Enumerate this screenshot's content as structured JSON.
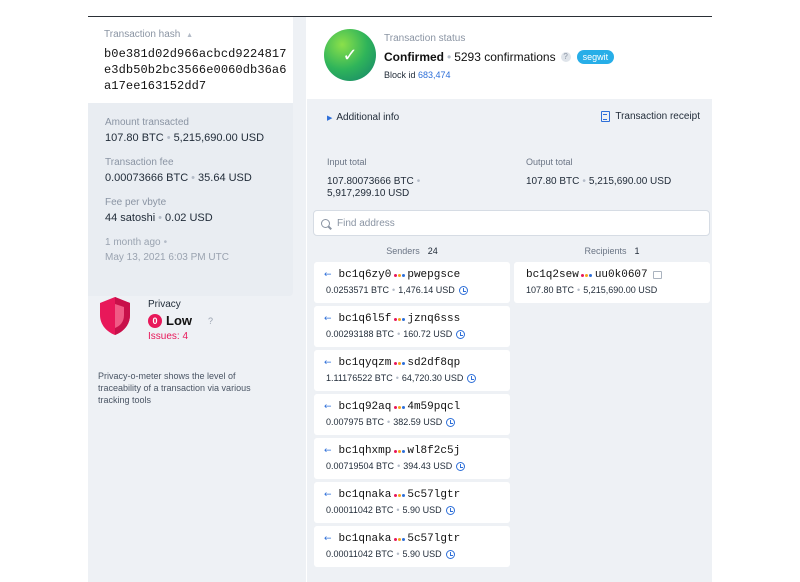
{
  "tx": {
    "hash_label": "Transaction hash",
    "hash_lines": [
      "b0e381d02d966acbcd9224817",
      "e3db50b2bc3566e0060db36a6",
      "a17ee163152dd7"
    ],
    "amount_label": "Amount transacted",
    "amount_btc": "107.80 BTC",
    "amount_usd": "5,215,690.00 USD",
    "fee_label": "Transaction fee",
    "fee_btc": "0.00073666 BTC",
    "fee_usd": "35.64 USD",
    "fee_vbyte_label": "Fee per vbyte",
    "fee_vbyte_sat": "44 satoshi",
    "fee_vbyte_usd": "0.02 USD",
    "time_ago": "1 month ago",
    "time_full": "May 13, 2021 6:03 PM UTC"
  },
  "privacy": {
    "label": "Privacy",
    "score": "0",
    "level": "Low",
    "help": "?",
    "issues": "Issues: 4",
    "description": "Privacy-o-meter shows the level of traceability of a transaction via various tracking tools",
    "color": "#e8185a"
  },
  "status": {
    "label": "Transaction status",
    "state": "Confirmed",
    "confirmations": "5293 confirmations",
    "help": "?",
    "badge": "segwit",
    "block_label": "Block id",
    "block_id": "683,474",
    "check_glyph": "✓"
  },
  "links": {
    "additional_info": "Additional info",
    "receipt": "Transaction receipt"
  },
  "totals": {
    "input_label": "Input total",
    "input_btc": "107.80073666 BTC",
    "input_usd": "5,917,299.10 USD",
    "output_label": "Output total",
    "output_btc": "107.80 BTC",
    "output_usd": "5,215,690.00 USD"
  },
  "search": {
    "placeholder": "Find address"
  },
  "senders": {
    "label": "Senders",
    "count": "24",
    "items": [
      {
        "addr_a": "bc1q6zy0",
        "addr_b": "pwepgsce",
        "btc": "0.0253571 BTC",
        "usd": "1,476.14 USD"
      },
      {
        "addr_a": "bc1q6l5f",
        "addr_b": "jznq6sss",
        "btc": "0.00293188 BTC",
        "usd": "160.72 USD"
      },
      {
        "addr_a": "bc1qyqzm",
        "addr_b": "sd2df8qp",
        "btc": "1.11176522 BTC",
        "usd": "64,720.30 USD"
      },
      {
        "addr_a": "bc1q92aq",
        "addr_b": "4m59pqcl",
        "btc": "0.007975 BTC",
        "usd": "382.59 USD"
      },
      {
        "addr_a": "bc1qhxmp",
        "addr_b": "wl8f2c5j",
        "btc": "0.00719504 BTC",
        "usd": "394.43 USD"
      },
      {
        "addr_a": "bc1qnaka",
        "addr_b": "5c57lgtr",
        "btc": "0.00011042 BTC",
        "usd": "5.90 USD"
      },
      {
        "addr_a": "bc1qnaka",
        "addr_b": "5c57lgtr",
        "btc": "0.00011042 BTC",
        "usd": "5.90 USD"
      }
    ]
  },
  "recipients": {
    "label": "Recipients",
    "count": "1",
    "items": [
      {
        "addr_a": "bc1q2sew",
        "addr_b": "uu0k0607",
        "btc": "107.80 BTC",
        "usd": "5,215,690.00 USD"
      }
    ]
  },
  "colors": {
    "accent": "#2e6fd8",
    "segwit": "#27aee8",
    "danger": "#e8185a",
    "dot_colors": [
      "#e8185a",
      "#f7a21b",
      "#2e6fd8"
    ]
  }
}
